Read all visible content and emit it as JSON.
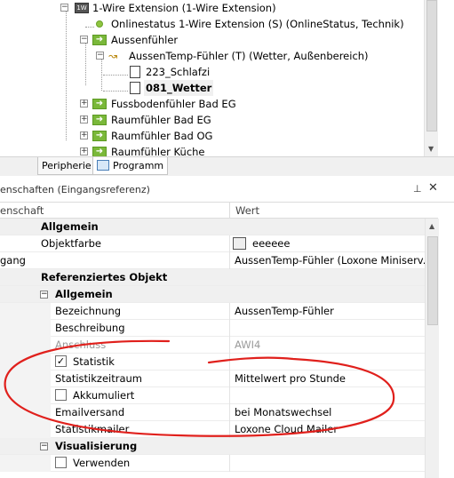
{
  "tree": {
    "items": [
      {
        "label": "1-Wire Extension (1-Wire Extension)",
        "icon": "device-icon"
      },
      {
        "label": "Onlinestatus 1-Wire Extension (S) (OnlineStatus, Technik)",
        "icon": "status-dot-icon"
      },
      {
        "label": "Aussenfühler",
        "icon": "folder-green-icon"
      },
      {
        "label": "AussenTemp-Fühler (T) (Wetter, Außenbereich)",
        "icon": "sensor-wave-icon"
      },
      {
        "label": "223_Schlafzi",
        "icon": "document-icon"
      },
      {
        "label": "081_Wetter",
        "icon": "document-icon",
        "selected": true
      },
      {
        "label": "Fussbodenfühler Bad EG",
        "icon": "folder-green-icon"
      },
      {
        "label": "Raumfühler Bad EG",
        "icon": "folder-green-icon"
      },
      {
        "label": "Raumfühler Bad OG",
        "icon": "folder-green-icon"
      },
      {
        "label": "Raumfühler Küche",
        "icon": "folder-green-icon"
      }
    ]
  },
  "tabs": [
    {
      "label": "Peripherie"
    },
    {
      "label": "Programm",
      "icon": "program-icon"
    }
  ],
  "props": {
    "title": "enschaften (Eingangsreferenz)",
    "col_name": "enschaft",
    "col_value": "Wert",
    "rows": [
      {
        "kind": "cat",
        "name": "Allgemein"
      },
      {
        "kind": "prop",
        "name": "Objektfarbe",
        "value": "eeeeee",
        "swatch": "#eeeeee"
      },
      {
        "kind": "prop",
        "name": "gang",
        "value": "AussenTemp-Fühler (Loxone Miniserv..."
      },
      {
        "kind": "cat",
        "name": "Referenziertes Objekt"
      },
      {
        "kind": "subcat",
        "name": "Allgemein"
      },
      {
        "kind": "prop",
        "name": "Bezeichnung",
        "value": "AussenTemp-Fühler"
      },
      {
        "kind": "prop",
        "name": "Beschreibung",
        "value": ""
      },
      {
        "kind": "prop-disabled",
        "name": "Anschluss",
        "value": "AWI4"
      },
      {
        "kind": "check",
        "name": "Statistik",
        "checked": true
      },
      {
        "kind": "prop",
        "name": "Statistikzeitraum",
        "value": "Mittelwert pro Stunde"
      },
      {
        "kind": "check",
        "name": "Akkumuliert",
        "checked": false
      },
      {
        "kind": "prop",
        "name": "Emailversand",
        "value": "bei Monatswechsel"
      },
      {
        "kind": "prop",
        "name": "Statistikmailer",
        "value": "Loxone Cloud Mailer"
      },
      {
        "kind": "subcat",
        "name": "Visualisierung"
      },
      {
        "kind": "check",
        "name": "Verwenden",
        "checked": false
      }
    ]
  },
  "colors": {
    "annotation": "#e0201c",
    "accent_green": "#7ab83a"
  }
}
